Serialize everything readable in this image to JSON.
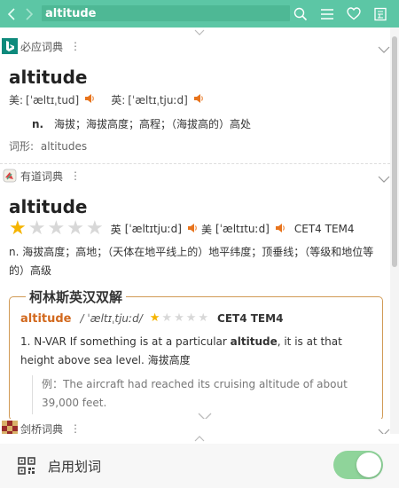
{
  "search": {
    "value": "altitude"
  },
  "colors": {
    "accent": "#5cc6a5",
    "speaker": "#e8741d",
    "star_on": "#f5b400",
    "star_off": "#d8d8d8",
    "collins_border": "#d19a55",
    "toggle_on": "#8fd49a"
  },
  "bing": {
    "name": "必应词典",
    "word": "altitude",
    "us_label": "美:",
    "us_phon": "[ˈæltɪˌtud]",
    "uk_label": "英:",
    "uk_phon": "[ˈæltɪˌtjuːd]",
    "pos": "n.",
    "definition": "海拔；海拔高度；高程；（海拔高的）高处",
    "forms_label": "词形:",
    "forms": "altitudes"
  },
  "youdao": {
    "name": "有道词典",
    "word": "altitude",
    "rating": 1,
    "rating_max": 5,
    "uk_label": "英",
    "uk_phon": "[ˈæltɪtjuːd]",
    "us_label": "美",
    "us_phon": "[ˈæltɪtuːd]",
    "tags": "CET4 TEM4",
    "definition": "n. 海拔高度；高地；（天体在地平线上的）地平纬度；顶垂线；（等级和地位等的）高级",
    "collins": {
      "title": "柯林斯英汉双解",
      "word": "altitude",
      "phon": "/ ˈæltɪˌtjuːd/",
      "rating": 1,
      "rating_max": 5,
      "tags": "CET4 TEM4",
      "sense_num": "1.",
      "sense_pre": "N-VAR If something is at a particular ",
      "sense_bold": "altitude",
      "sense_post": ", it is at that height above sea level. 海拔高度",
      "example_label": "例：",
      "example": "The aircraft had reached its cruising altitude of about 39,000 feet."
    }
  },
  "cambridge": {
    "name": "剑桥词典"
  },
  "bottom": {
    "label": "启用划词",
    "toggle_on": true
  }
}
